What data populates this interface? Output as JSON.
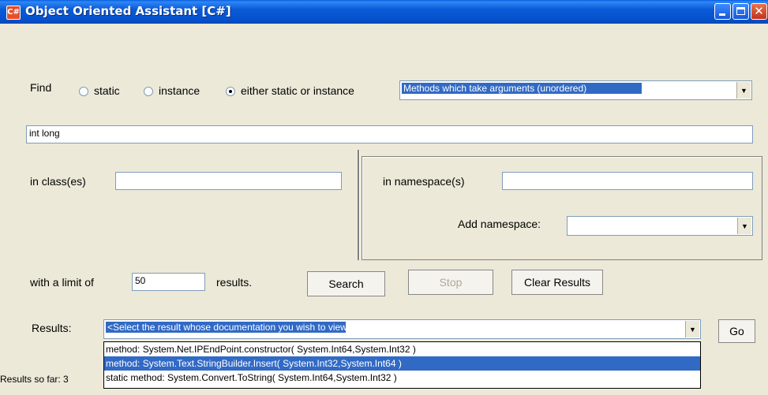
{
  "window": {
    "title": "Object Oriented Assistant [C#]",
    "icon_text": "C#"
  },
  "find": {
    "label": "Find",
    "radios": [
      {
        "label": "static",
        "checked": false
      },
      {
        "label": "instance",
        "checked": false
      },
      {
        "label": "either static or instance",
        "checked": true
      }
    ],
    "mode_select": "Methods which take arguments (unordered)"
  },
  "args_input": "int long",
  "classes": {
    "label": "in class(es)",
    "value": ""
  },
  "namespaces": {
    "label": "in namespace(s)",
    "value": "",
    "add_label": "Add namespace:",
    "add_value": ""
  },
  "limit": {
    "label": "with a limit of",
    "value": "50",
    "suffix": "results."
  },
  "buttons": {
    "search": "Search",
    "stop": "Stop",
    "clear": "Clear Results",
    "go": "Go"
  },
  "results": {
    "label": "Results:",
    "selected": "<Select the result whose documentation you wish to view>",
    "items": [
      "method: System.Net.IPEndPoint.constructor( System.Int64,System.Int32 )",
      "method: System.Text.StringBuilder.Insert( System.Int32,System.Int64 )",
      "static method: System.Convert.ToString( System.Int64,System.Int32 )"
    ],
    "highlighted_index": 1
  },
  "status": "Results so far: 3"
}
